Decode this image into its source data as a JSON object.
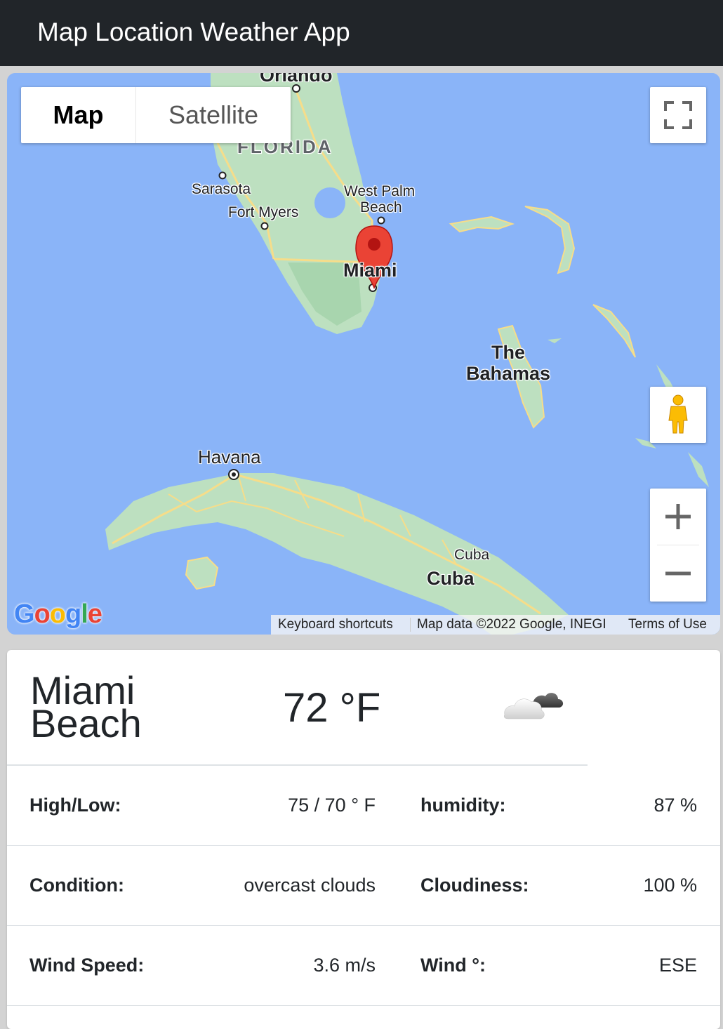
{
  "navbar": {
    "title": "Map Location Weather App"
  },
  "map": {
    "type_control": {
      "map_label": "Map",
      "satellite_label": "Satellite",
      "selected": "Map"
    },
    "labels": {
      "orlando": "Orlando",
      "florida": "FLORIDA",
      "sarasota": "Sarasota",
      "fort_myers": "Fort Myers",
      "west_palm": "West Palm",
      "beach": "Beach",
      "miami": "Miami",
      "the": "The",
      "bahamas": "Bahamas",
      "havana": "Havana",
      "cuba_small": "Cuba",
      "cuba_big": "Cuba"
    },
    "marker": {
      "city": "Miami",
      "color": "#ea4335"
    },
    "footer": {
      "keyboard": "Keyboard shortcuts",
      "data": "Map data ©2022 Google, INEGI",
      "terms": "Terms of Use"
    },
    "logo": "Google",
    "icons": [
      "fullscreen-icon",
      "pegman-icon",
      "zoom-in-icon",
      "zoom-out-icon"
    ]
  },
  "weather": {
    "city": "Miami Beach",
    "temperature": "72 °F",
    "icon": "overcast-clouds-icon",
    "rows": [
      {
        "label1": "High/Low:",
        "value1": "75 / 70 ° F",
        "label2": "humidity:",
        "value2": "87 %"
      },
      {
        "label1": "Condition:",
        "value1": "overcast clouds",
        "label2": "Cloudiness:",
        "value2": "100 %"
      },
      {
        "label1": "Wind Speed:",
        "value1": "3.6 m/s",
        "label2": "Wind °:",
        "value2": "ESE"
      }
    ]
  },
  "colors": {
    "navbar": "#212529",
    "water": "#8ab4f8",
    "land": "#bde0c0",
    "roads": "#f6dd8a",
    "marker": "#ea4335"
  }
}
